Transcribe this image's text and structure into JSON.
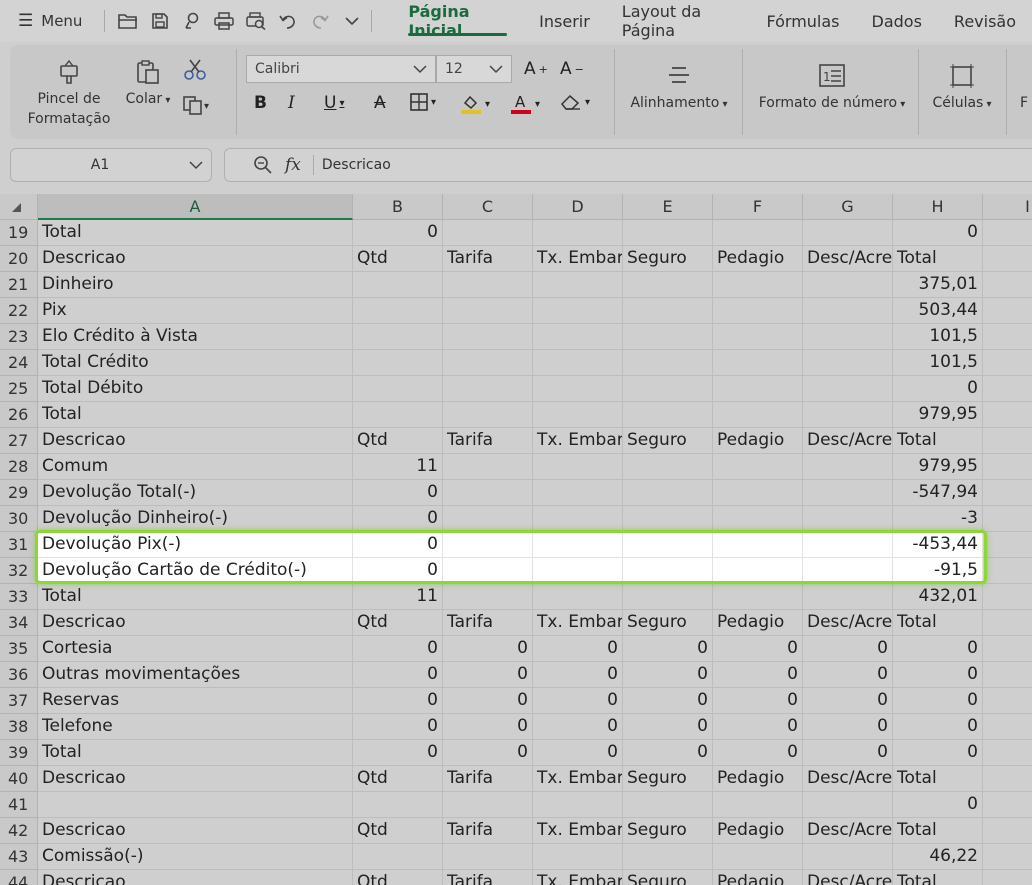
{
  "menubar": {
    "menu_label": "Menu",
    "quick_access_icons": [
      "open-folder-icon",
      "save-icon",
      "quick-icon",
      "print-icon",
      "print-preview-icon",
      "undo-icon",
      "redo-icon",
      "more-chevron-icon"
    ],
    "tabs": [
      {
        "label": "Página Inicial",
        "active": true
      },
      {
        "label": "Inserir",
        "active": false
      },
      {
        "label": "Layout da Página",
        "active": false
      },
      {
        "label": "Fórmulas",
        "active": false
      },
      {
        "label": "Dados",
        "active": false
      },
      {
        "label": "Revisão",
        "active": false
      }
    ]
  },
  "ribbon": {
    "format_painter_line1": "Pincel de",
    "format_painter_line2": "Formatação",
    "paste_label": "Colar",
    "font_name": "Calibri",
    "font_size": "12",
    "align_label": "Alinhamento",
    "number_format_label": "Formato de número",
    "cells_label": "Células",
    "cut_partial": "F",
    "highlight_color": "#e2c21f",
    "font_color": "#d0021b"
  },
  "formula_bar": {
    "cell_ref": "A1",
    "fx": "fx",
    "content": "Descricao"
  },
  "columns": [
    "A",
    "B",
    "C",
    "D",
    "E",
    "F",
    "G",
    "H",
    "I"
  ],
  "colors": {
    "accent": "#1c6b3e",
    "selection_outline": "#8ed53a"
  },
  "rows": [
    {
      "n": "19",
      "cells": [
        "Total",
        "0",
        "",
        "",
        "",
        "",
        "",
        "0"
      ]
    },
    {
      "n": "20",
      "cells": [
        "Descricao",
        "Qtd",
        "Tarifa",
        "Tx. Embarque",
        "Seguro",
        "Pedagio",
        "Desc/Acrescimo",
        "Total"
      ]
    },
    {
      "n": "21",
      "cells": [
        "Dinheiro",
        "",
        "",
        "",
        "",
        "",
        "",
        "375,01"
      ]
    },
    {
      "n": "22",
      "cells": [
        "Pix",
        "",
        "",
        "",
        "",
        "",
        "",
        "503,44"
      ]
    },
    {
      "n": "23",
      "cells": [
        "Elo Crédito à Vista",
        "",
        "",
        "",
        "",
        "",
        "",
        "101,5"
      ]
    },
    {
      "n": "24",
      "cells": [
        "Total Crédito",
        "",
        "",
        "",
        "",
        "",
        "",
        "101,5"
      ]
    },
    {
      "n": "25",
      "cells": [
        "Total Débito",
        "",
        "",
        "",
        "",
        "",
        "",
        "0"
      ]
    },
    {
      "n": "26",
      "cells": [
        "Total",
        "",
        "",
        "",
        "",
        "",
        "",
        "979,95"
      ]
    },
    {
      "n": "27",
      "cells": [
        "Descricao",
        "Qtd",
        "Tarifa",
        "Tx. Embarque",
        "Seguro",
        "Pedagio",
        "Desc/Acrescimo",
        "Total"
      ]
    },
    {
      "n": "28",
      "cells": [
        "Comum",
        "11",
        "",
        "",
        "",
        "",
        "",
        "979,95"
      ]
    },
    {
      "n": "29",
      "cells": [
        "Devolução Total(-)",
        "0",
        "",
        "",
        "",
        "",
        "",
        "-547,94"
      ]
    },
    {
      "n": "30",
      "cells": [
        "Devolução Dinheiro(-)",
        "0",
        "",
        "",
        "",
        "",
        "",
        "-3"
      ]
    },
    {
      "n": "31",
      "cells": [
        "Devolução Pix(-)",
        "0",
        "",
        "",
        "",
        "",
        "",
        "-453,44"
      ],
      "highlight": true
    },
    {
      "n": "32",
      "cells": [
        "Devolução Cartão de Crédito(-)",
        "0",
        "",
        "",
        "",
        "",
        "",
        "-91,5"
      ],
      "highlight": true
    },
    {
      "n": "33",
      "cells": [
        "Total",
        "11",
        "",
        "",
        "",
        "",
        "",
        "432,01"
      ]
    },
    {
      "n": "34",
      "cells": [
        "Descricao",
        "Qtd",
        "Tarifa",
        "Tx. Embarque",
        "Seguro",
        "Pedagio",
        "Desc/Acrescimo",
        "Total"
      ]
    },
    {
      "n": "35",
      "cells": [
        "Cortesia",
        "0",
        "0",
        "0",
        "0",
        "0",
        "0",
        "0"
      ]
    },
    {
      "n": "36",
      "cells": [
        "Outras movimentações",
        "0",
        "0",
        "0",
        "0",
        "0",
        "0",
        "0"
      ]
    },
    {
      "n": "37",
      "cells": [
        "Reservas",
        "0",
        "0",
        "0",
        "0",
        "0",
        "0",
        "0"
      ]
    },
    {
      "n": "38",
      "cells": [
        "Telefone",
        "0",
        "0",
        "0",
        "0",
        "0",
        "0",
        "0"
      ]
    },
    {
      "n": "39",
      "cells": [
        "Total",
        "0",
        "0",
        "0",
        "0",
        "0",
        "0",
        "0"
      ]
    },
    {
      "n": "40",
      "cells": [
        "Descricao",
        "Qtd",
        "Tarifa",
        "Tx. Embarque",
        "Seguro",
        "Pedagio",
        "Desc/Acrescimo",
        "Total"
      ]
    },
    {
      "n": "41",
      "cells": [
        "",
        "",
        "",
        "",
        "",
        "",
        "",
        "0"
      ]
    },
    {
      "n": "42",
      "cells": [
        "Descricao",
        "Qtd",
        "Tarifa",
        "Tx. Embarque",
        "Seguro",
        "Pedagio",
        "Desc/Acrescimo",
        "Total"
      ]
    },
    {
      "n": "43",
      "cells": [
        "Comissão(-)",
        "",
        "",
        "",
        "",
        "",
        "",
        "46,22"
      ]
    },
    {
      "n": "44",
      "cells": [
        "Descricao",
        "Qtd",
        "Tarifa",
        "Tx. Embarque",
        "Seguro",
        "Pedagio",
        "Desc/Acrescimo",
        "Total"
      ]
    }
  ]
}
